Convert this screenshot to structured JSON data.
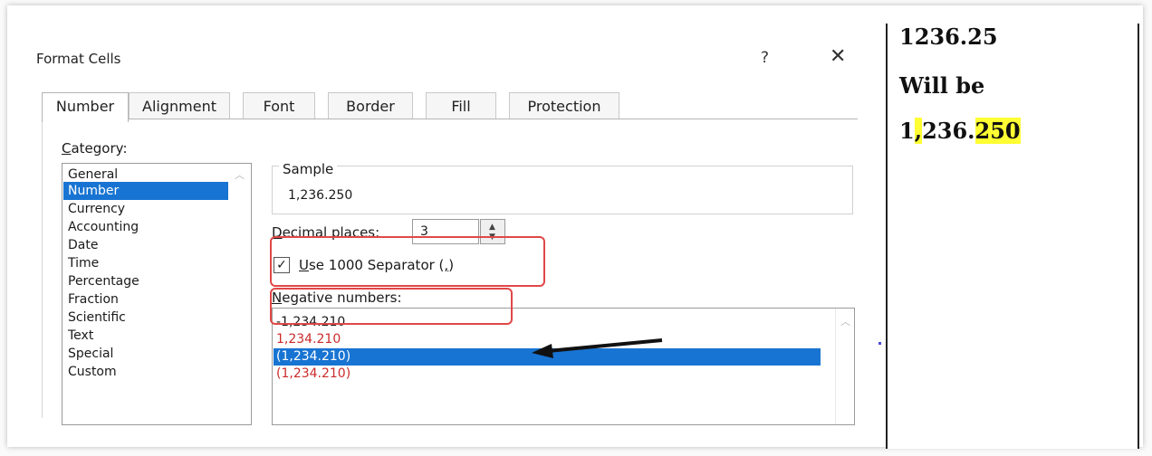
{
  "dialog": {
    "title": "Format Cells",
    "help": "?",
    "close": "✕"
  },
  "tabs": [
    {
      "label": "Number"
    },
    {
      "label": "Alignment"
    },
    {
      "label": "Font"
    },
    {
      "label": "Border"
    },
    {
      "label": "Fill"
    },
    {
      "label": "Protection"
    }
  ],
  "category": {
    "label": "Category:",
    "items": [
      "General",
      "Number",
      "Currency",
      "Accounting",
      "Date",
      "Time",
      "Percentage",
      "Fraction",
      "Scientific",
      "Text",
      "Special",
      "Custom"
    ],
    "selected": "Number"
  },
  "sample": {
    "label": "Sample",
    "value": "1,236.250"
  },
  "decimal_places": {
    "label": "Decimal places:",
    "value": "3"
  },
  "separator": {
    "label": "Use 1000 Separator (,)",
    "checked": true,
    "check_glyph": "✓"
  },
  "negative_numbers": {
    "label": "Negative numbers:",
    "items": [
      {
        "text": "-1,234.210",
        "color": "#1a1a1a"
      },
      {
        "text": "1,234.210",
        "color": "#cc2b2b"
      },
      {
        "text": "(1,234.210)",
        "color": "#ffffff",
        "selected": true
      },
      {
        "text": "(1,234.210)",
        "color": "#cc2b2b"
      }
    ]
  },
  "colors": {
    "selection": "#1874d2",
    "annotation_box": "#e04848",
    "negative_red": "#cc2b2b",
    "highlight": "#ffff33"
  },
  "icons": {
    "scroll_up": "up-chevron",
    "spin": "spin-up-down",
    "arrow": "annotation-arrow-left"
  },
  "notes": {
    "line1": "1236.25",
    "line2": "Will be",
    "line3_part1": "1",
    "line3_part2": ",",
    "line3_part3": "236.",
    "line3_part4": "250"
  }
}
